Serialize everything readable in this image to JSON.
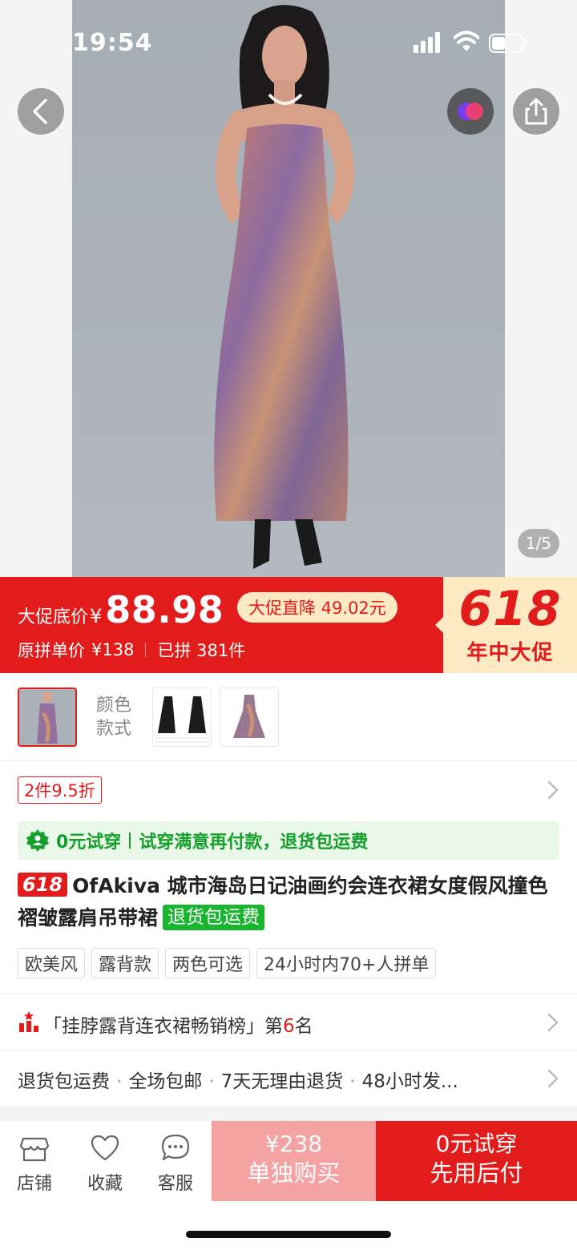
{
  "status_bar": {
    "time": "19:54"
  },
  "gallery": {
    "counter": "1/5"
  },
  "promo": {
    "price_label": "大促底价",
    "currency": "¥",
    "price": "88.98",
    "drop_text": "大促直降 49.02元",
    "original_label": "原拼单价",
    "original_price": "¥138",
    "sold_text": "已拼 381件",
    "event_number": "618",
    "event_text": "年中大促"
  },
  "variants": {
    "label_line1": "颜色",
    "label_line2": "款式"
  },
  "discount": {
    "tag": "2件9.5折"
  },
  "trial_banner": {
    "main": "0元试穿",
    "detail": "试穿满意再付款，退货包运费"
  },
  "product": {
    "badge": "618",
    "title": "OfAkiva 城市海岛日记油画约会连衣裙女度假风撞色褶皱露肩吊带裙",
    "free_return_badge": "退货包运费",
    "tags": [
      "欧美风",
      "露背款",
      "两色可选",
      "24小时内70+人拼单"
    ]
  },
  "rank": {
    "prefix": "「挂脖露背连衣裙畅销榜」第",
    "number": "6",
    "suffix": "名"
  },
  "services": [
    "退货包运费",
    "全场包邮",
    "7天无理由退货",
    "48小时发..."
  ],
  "bottom_bar": {
    "store": "店铺",
    "favorite": "收藏",
    "service": "客服",
    "solo_price": "¥238",
    "solo_label": "单独购买",
    "trial_line1": "0元试穿",
    "trial_line2": "先用后付"
  },
  "colors": {
    "accent": "#e21b1b",
    "promo_cream": "#fde9c4",
    "green": "#15a02b",
    "solo_button": "#f4a2a2"
  },
  "icons": [
    "back-icon",
    "ai-color-icon",
    "share-icon",
    "store-icon",
    "heart-icon",
    "chat-icon",
    "chevron-right-icon",
    "rank-icon",
    "trial-icon"
  ]
}
